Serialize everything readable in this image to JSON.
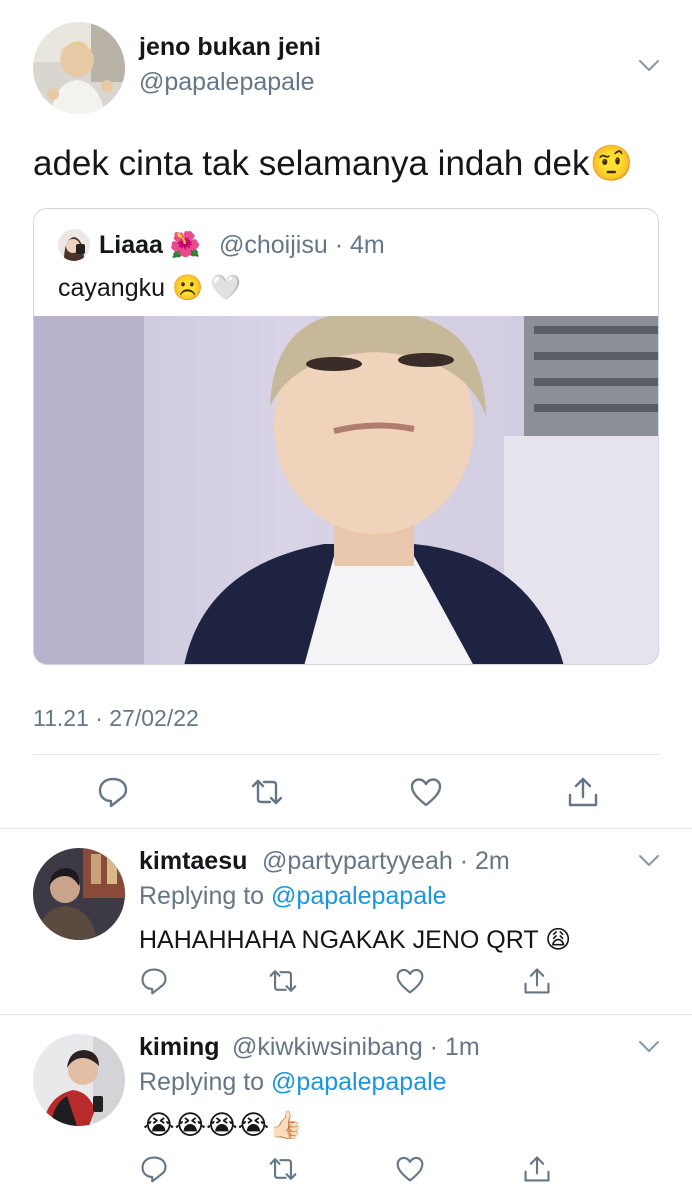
{
  "main_tweet": {
    "display_name": "jeno bukan jeni",
    "handle": "@papalepapale",
    "text": "adek cinta tak selamanya indah dek",
    "text_emoji": "🤨",
    "timestamp": "11.21 · 27/02/22",
    "quoted": {
      "display_name": "Liaaa",
      "name_emoji": "🌺",
      "handle_time": "@choijisu · 4m",
      "text": "cayangku",
      "text_emojis": "☹️ 🤍"
    }
  },
  "replies": [
    {
      "display_name": "kimtaesu",
      "handle_time": "@partypartyyeah · 2m",
      "replying_prefix": "Replying to",
      "replying_handle": "@papalepapale",
      "text": "HAHAHHAHA NGAKAK JENO QRT",
      "text_emoji": "😩"
    },
    {
      "display_name": "kiming",
      "handle_time": "@kiwkiwsinibang · 1m",
      "replying_prefix": "Replying to",
      "replying_handle": "@papalepapale",
      "text": "",
      "text_emoji": "😭😭😭😭👍🏻"
    }
  ],
  "icons": {
    "reply": "reply-icon",
    "retweet": "retweet-icon",
    "like": "like-icon",
    "share": "share-icon",
    "more": "chevron-down-icon"
  },
  "colors": {
    "text": "#14171a",
    "secondary": "#657786",
    "link": "#1b95e0",
    "border": "#ccd6dd"
  }
}
